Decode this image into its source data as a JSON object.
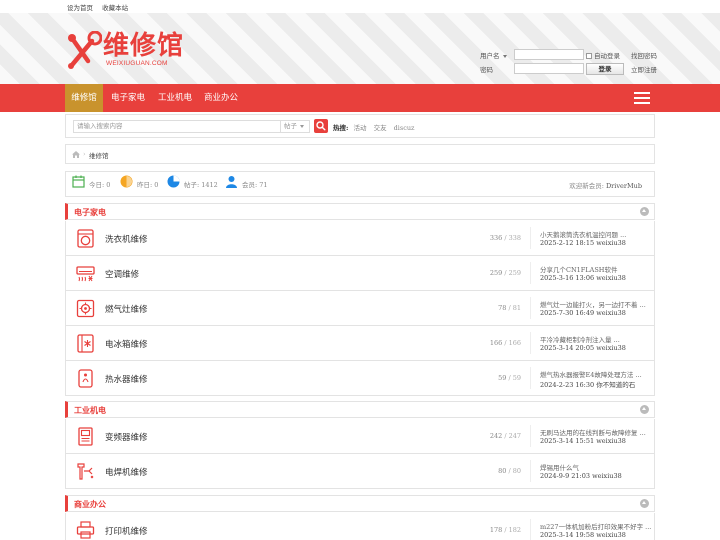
{
  "topbar": {
    "set_home": "设为首页",
    "bookmark": "收藏本站"
  },
  "logo": {
    "brand": "维修馆",
    "domain": "WEIXIUGUAN.COM"
  },
  "login": {
    "username_label": "用户名",
    "password_label": "密码",
    "auto_login": "自动登录",
    "forgot": "找回密码",
    "submit": "登录",
    "register": "立即注册"
  },
  "nav": {
    "items": [
      "维修馆",
      "电子家电",
      "工业机电",
      "商业办公"
    ]
  },
  "search": {
    "placeholder": "请输入搜索内容",
    "scope": "帖子",
    "hot_label": "热搜:",
    "hot": [
      "活动",
      "交友",
      "discuz"
    ]
  },
  "breadcrumb": {
    "current": "维修馆"
  },
  "stats": {
    "today": "今日: 0",
    "yesterday": "昨日: 0",
    "posts": "帖子: 1412",
    "members": "会员: 71",
    "welcome_prefix": "欢迎新会员: ",
    "welcome_user": "DriverMub"
  },
  "sections": [
    {
      "title": "电子家电",
      "forums": [
        {
          "name": "洗衣机维修",
          "threads": "336",
          "posts": "338",
          "last_title": "小天鹅滚筒洗衣机温控问题 ...",
          "last_meta": "2025-2-12 18:15 weixiu38"
        },
        {
          "name": "空调维修",
          "threads": "259",
          "posts": "259",
          "last_title": "分享几个CN1FLASH软件",
          "last_meta": "2025-3-16 13:06 weixiu38"
        },
        {
          "name": "燃气灶维修",
          "threads": "78",
          "posts": "81",
          "last_title": "燃气灶一边能打火，另一边打不着 ...",
          "last_meta": "2025-7-30 16:49 weixiu38"
        },
        {
          "name": "电冰箱维修",
          "threads": "166",
          "posts": "166",
          "last_title": "平冷冷藏柜制冷剂注入量 ...",
          "last_meta": "2025-3-14 20:05 weixiu38"
        },
        {
          "name": "热水器维修",
          "threads": "59",
          "posts": "59",
          "last_title": "燃气热水器报警E4故障处理方法 ...",
          "last_meta": "2024-2-23 16:30 你不知道的石"
        }
      ]
    },
    {
      "title": "工业机电",
      "forums": [
        {
          "name": "变频器维修",
          "threads": "242",
          "posts": "247",
          "last_title": "无刷马达用的在线判断与故障修复 ...",
          "last_meta": "2025-3-14 15:51 weixiu38"
        },
        {
          "name": "电焊机维修",
          "threads": "80",
          "posts": "80",
          "last_title": "焊锡用什么气",
          "last_meta": "2024-9-9 21:03 weixiu38"
        }
      ]
    },
    {
      "title": "商业办公",
      "forums": [
        {
          "name": "打印机维修",
          "threads": "178",
          "posts": "182",
          "last_title": "m227一体机加粉后打印效果不好字 ...",
          "last_meta": "2025-3-14 19:58 weixiu38"
        }
      ]
    }
  ],
  "colors": {
    "accent": "#e8403c",
    "nav_active": "#c9932d"
  }
}
